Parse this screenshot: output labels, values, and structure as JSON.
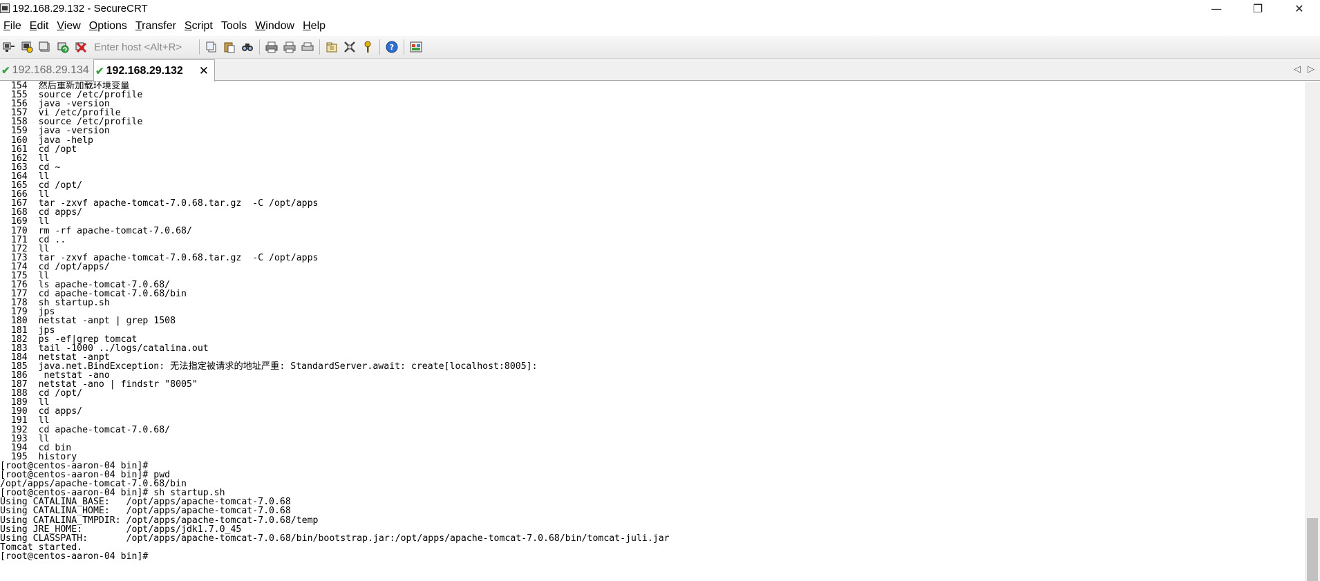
{
  "window": {
    "title": "192.168.29.132 - SecureCRT",
    "minimize": "—",
    "maximize": "❐",
    "close": "✕"
  },
  "menu": [
    {
      "label": "File",
      "mnemonic": "F",
      "rest": "ile"
    },
    {
      "label": "Edit",
      "mnemonic": "E",
      "rest": "dit"
    },
    {
      "label": "View",
      "mnemonic": "V",
      "rest": "iew"
    },
    {
      "label": "Options",
      "mnemonic": "O",
      "rest": "ptions"
    },
    {
      "label": "Transfer",
      "mnemonic": "T",
      "rest": "ransfer"
    },
    {
      "label": "Script",
      "mnemonic": "S",
      "rest": "cript"
    },
    {
      "label": "Tools",
      "mnemonic": "",
      "rest": "Tools"
    },
    {
      "label": "Window",
      "mnemonic": "W",
      "rest": "indow"
    },
    {
      "label": "Help",
      "mnemonic": "H",
      "rest": "elp"
    }
  ],
  "toolbar": {
    "host_placeholder": "Enter host <Alt+R>"
  },
  "tabs": {
    "inactive": "192.168.29.134",
    "active": "192.168.29.132",
    "close_glyph": "✕",
    "scroll_left": "◁",
    "scroll_right": "▷"
  },
  "terminal": {
    "lines": [
      "  154  然后重新加载环境变量",
      "  155  source /etc/profile",
      "  156  java -version",
      "  157  vi /etc/profile",
      "  158  source /etc/profile",
      "  159  java -version",
      "  160  java -help",
      "  161  cd /opt",
      "  162  ll",
      "  163  cd ~",
      "  164  ll",
      "  165  cd /opt/",
      "  166  ll",
      "  167  tar -zxvf apache-tomcat-7.0.68.tar.gz  -C /opt/apps",
      "  168  cd apps/",
      "  169  ll",
      "  170  rm -rf apache-tomcat-7.0.68/",
      "  171  cd ..",
      "  172  ll",
      "  173  tar -zxvf apache-tomcat-7.0.68.tar.gz  -C /opt/apps",
      "  174  cd /opt/apps/",
      "  175  ll",
      "  176  ls apache-tomcat-7.0.68/",
      "  177  cd apache-tomcat-7.0.68/bin",
      "  178  sh startup.sh",
      "  179  jps",
      "  180  netstat -anpt | grep 1508",
      "  181  jps",
      "  182  ps -ef|grep tomcat",
      "  183  tail -1000 ../logs/catalina.out",
      "  184  netstat -anpt",
      "  185  java.net.BindException: 无法指定被请求的地址严重: StandardServer.await: create[localhost:8005]:",
      "  186   netstat -ano",
      "  187  netstat -ano | findstr \"8005\"",
      "  188  cd /opt/",
      "  189  ll",
      "  190  cd apps/",
      "  191  ll",
      "  192  cd apache-tomcat-7.0.68/",
      "  193  ll",
      "  194  cd bin",
      "  195  history",
      "[root@centos-aaron-04 bin]#",
      "[root@centos-aaron-04 bin]# pwd",
      "/opt/apps/apache-tomcat-7.0.68/bin",
      "[root@centos-aaron-04 bin]# sh startup.sh",
      "Using CATALINA_BASE:   /opt/apps/apache-tomcat-7.0.68",
      "Using CATALINA_HOME:   /opt/apps/apache-tomcat-7.0.68",
      "Using CATALINA_TMPDIR: /opt/apps/apache-tomcat-7.0.68/temp",
      "Using JRE_HOME:        /opt/apps/jdk1.7.0_45",
      "Using CLASSPATH:       /opt/apps/apache-tomcat-7.0.68/bin/bootstrap.jar:/opt/apps/apache-tomcat-7.0.68/bin/tomcat-juli.jar",
      "Tomcat started.",
      "[root@centos-aaron-04 bin]#"
    ]
  },
  "colors": {
    "check": "#2fa53a",
    "help_icon": "#2f6fd0",
    "disconnect_icon": "#cc2222"
  }
}
